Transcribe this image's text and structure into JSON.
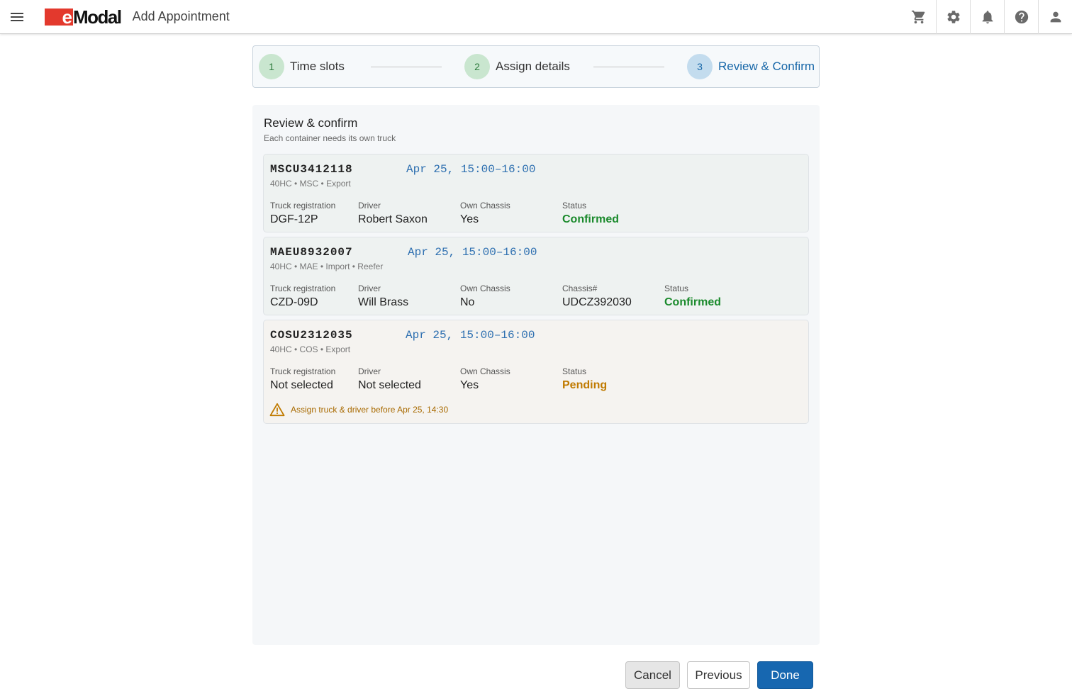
{
  "header": {
    "logo_e": "e",
    "logo_rest": "Modal",
    "title": "Add Appointment",
    "icons": [
      "cart-icon",
      "gear-icon",
      "bell-icon",
      "help-icon",
      "user-icon"
    ]
  },
  "stepper": {
    "steps": [
      {
        "number": "1",
        "label": "Time  slots",
        "state": "done"
      },
      {
        "number": "2",
        "label": "Assign details",
        "state": "done"
      },
      {
        "number": "3",
        "label": "Review & Confirm",
        "state": "active"
      }
    ]
  },
  "review": {
    "title": "Review & confirm",
    "subtitle": "Each container needs its own truck",
    "labels": {
      "truck": "Truck registration",
      "driver": "Driver",
      "own_chassis": "Own Chassis",
      "chassis_no": "Chassis#",
      "status": "Status"
    },
    "cards": [
      {
        "container": "MSCU3412118",
        "slot": "Apr 25, 15:00–16:00",
        "meta": "40HC • MSC • Export",
        "truck": "DGF-12P",
        "driver": "Robert Saxon",
        "own_chassis": "Yes",
        "status": "Confirmed"
      },
      {
        "container": "MAEU8932007",
        "slot": "Apr 25, 15:00–16:00",
        "meta": "40HC • MAE • Import • Reefer",
        "truck": "CZD-09D",
        "driver": "Will Brass",
        "own_chassis": "No",
        "chassis_no": "UDCZ392030",
        "status": "Confirmed"
      },
      {
        "container": "COSU2312035",
        "slot": "Apr 25, 15:00–16:00",
        "meta": "40HC • COS • Export",
        "truck": "Not selected",
        "driver": "Not selected",
        "own_chassis": "Yes",
        "status": "Pending",
        "warning": "Assign truck & driver before Apr 25, 14:30"
      }
    ]
  },
  "footer": {
    "cancel": "Cancel",
    "previous": "Previous",
    "done": "Done"
  },
  "colors": {
    "brand_red": "#e3392d",
    "primary": "#1767b0",
    "confirmed": "#1a8a2c",
    "pending": "#c07a00"
  }
}
